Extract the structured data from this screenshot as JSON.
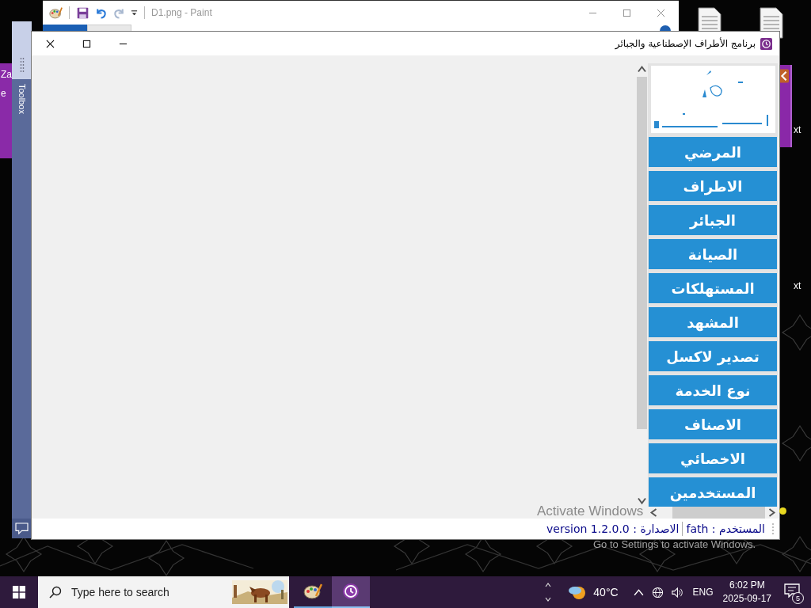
{
  "desktop_icons": [
    {
      "label": "xt"
    },
    {
      "label": "xt"
    }
  ],
  "background_windows": {
    "paint": {
      "title": "D1.png - Paint"
    },
    "toolbox": {
      "title": "Toolbox"
    },
    "purple_window_texts": [
      "Za",
      "e"
    ]
  },
  "app_window": {
    "title": "برنامج الأطراف الإصطناعية والجبائر",
    "sidebar": {
      "items": [
        {
          "label": "المرضي"
        },
        {
          "label": "الاطراف"
        },
        {
          "label": "الجبائر"
        },
        {
          "label": "الصيانة"
        },
        {
          "label": "المستهلكات"
        },
        {
          "label": "المشهد"
        },
        {
          "label": "تصدير لاكسل"
        },
        {
          "label": "نوع الخدمة"
        },
        {
          "label": "الاصناف"
        },
        {
          "label": "الاخصائي"
        },
        {
          "label": "المستخدمين"
        }
      ]
    },
    "status_bar": {
      "items": [
        "المستخدم : fath",
        "الاصدارة : version 1.2.0.0"
      ]
    }
  },
  "activation_notice": {
    "title": "Activate Windows",
    "message": "Go to Settings to activate Windows."
  },
  "taskbar": {
    "search": {
      "placeholder": "Type here to search"
    },
    "apps": [
      {
        "kind": "paint",
        "selected": false
      },
      {
        "kind": "app",
        "selected": true
      }
    ],
    "weather": "40°C",
    "language": "ENG",
    "time": "6:02 PM",
    "date": "2025-09-17",
    "notifications": "5"
  }
}
